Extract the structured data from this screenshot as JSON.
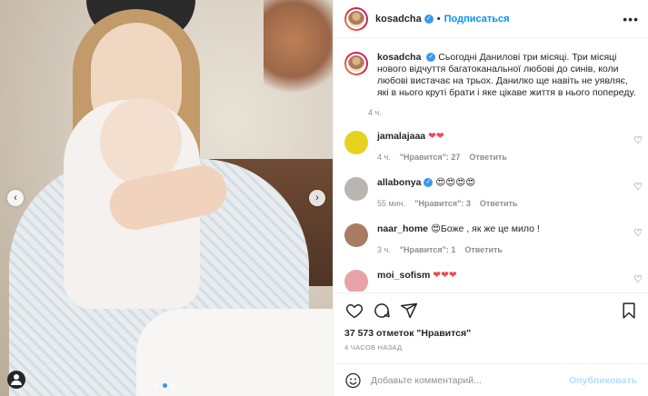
{
  "post": {
    "username": "kosadcha",
    "follow_label": "Подписаться",
    "separator": "•",
    "more_icon": "more-icon",
    "caption": "Сьогодні Данилові три місяці. Три місяці нового відчуття багатоканальної любові до синів, коли любові вистачає на трьох. Данилко ще навіть не уявляє, які в нього круті брати і яке цікаве життя в нього попереду.",
    "caption_time": "4 ч."
  },
  "comments": [
    {
      "user": "jamalajaaa",
      "text": "❤❤",
      "time": "4 ч.",
      "likes": "\"Нравится\": 27",
      "reply": "Ответить",
      "avatar_color": "#e6d11e",
      "verified": false
    },
    {
      "user": "allabonya",
      "text": "😍😍😍😍",
      "time": "55 мин.",
      "likes": "\"Нравится\": 3",
      "reply": "Ответить",
      "avatar_color": "#b9b5b0",
      "verified": true
    },
    {
      "user": "naar_home",
      "text": "😍Боже , як же це мило !",
      "time": "3 ч.",
      "likes": "\"Нравится\": 1",
      "reply": "Ответить",
      "avatar_color": "#a77c63",
      "verified": false
    },
    {
      "user": "moi_sofism",
      "text": "❤❤❤",
      "time": "",
      "likes": "",
      "reply": "",
      "avatar_color": "#e8a3a8",
      "verified": false
    }
  ],
  "stats": {
    "likes_text": "37 573 отметок \"Нравится\"",
    "time_text": "4 ЧАСОВ НАЗАД"
  },
  "add_comment": {
    "placeholder": "Добавьте комментарий...",
    "publish_label": "Опубликовать"
  },
  "nav": {
    "prev": "‹",
    "next": "›"
  },
  "colors": {
    "accent": "#0095f6",
    "verified": "#3897f0",
    "muted": "#8e8e8e",
    "heart": "#ed4956"
  }
}
